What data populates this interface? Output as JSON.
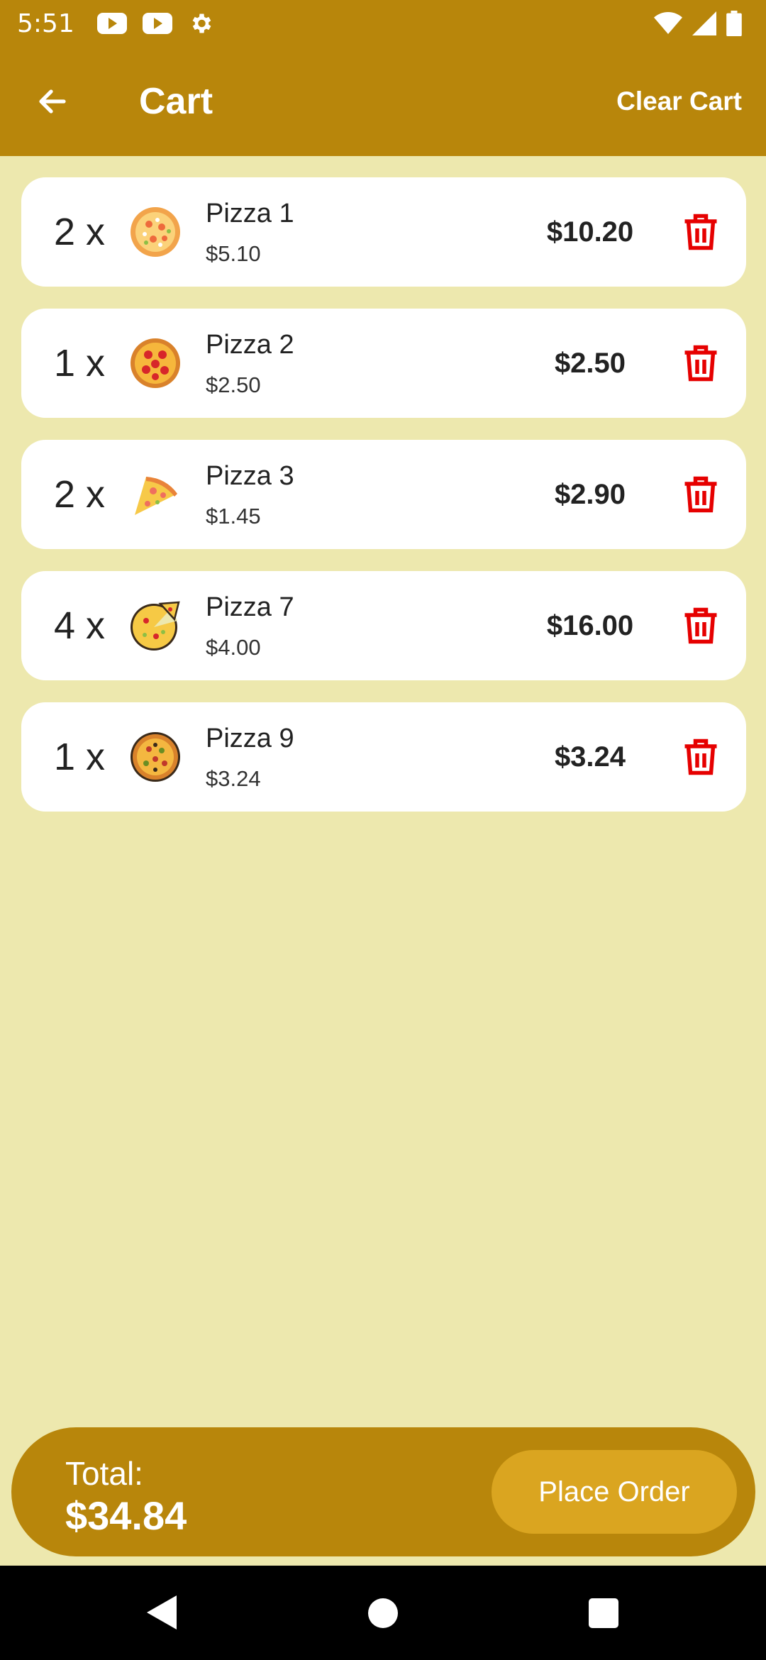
{
  "status_bar": {
    "time": "5:51",
    "icons": [
      "youtube-icon",
      "youtube-icon",
      "settings-gear-icon",
      "wifi-icon",
      "cell-signal-icon",
      "battery-icon"
    ]
  },
  "app_bar": {
    "back_icon": "arrow-left-icon",
    "title": "Cart",
    "clear_label": "Clear Cart"
  },
  "cart": {
    "items": [
      {
        "qty": "2 x",
        "icon": "pizza-whole-icon",
        "name": "Pizza 1",
        "unit_price": "$5.10",
        "line_total": "$10.20"
      },
      {
        "qty": "1 x",
        "icon": "pizza-pepperoni-icon",
        "name": "Pizza 2",
        "unit_price": "$2.50",
        "line_total": "$2.50"
      },
      {
        "qty": "2 x",
        "icon": "pizza-slice-icon",
        "name": "Pizza 3",
        "unit_price": "$1.45",
        "line_total": "$2.90"
      },
      {
        "qty": "4 x",
        "icon": "pizza-cut-icon",
        "name": "Pizza 7",
        "unit_price": "$4.00",
        "line_total": "$16.00"
      },
      {
        "qty": "1 x",
        "icon": "pizza-veggie-icon",
        "name": "Pizza 9",
        "unit_price": "$3.24",
        "line_total": "$3.24"
      }
    ],
    "delete_icon": "trash-icon"
  },
  "footer": {
    "total_label": "Total:",
    "total_value": "$34.84",
    "place_order_label": "Place Order"
  },
  "colors": {
    "primary": "#B8860B",
    "accent": "#DAA520",
    "background": "#EDE8AE",
    "delete": "#E60000"
  }
}
